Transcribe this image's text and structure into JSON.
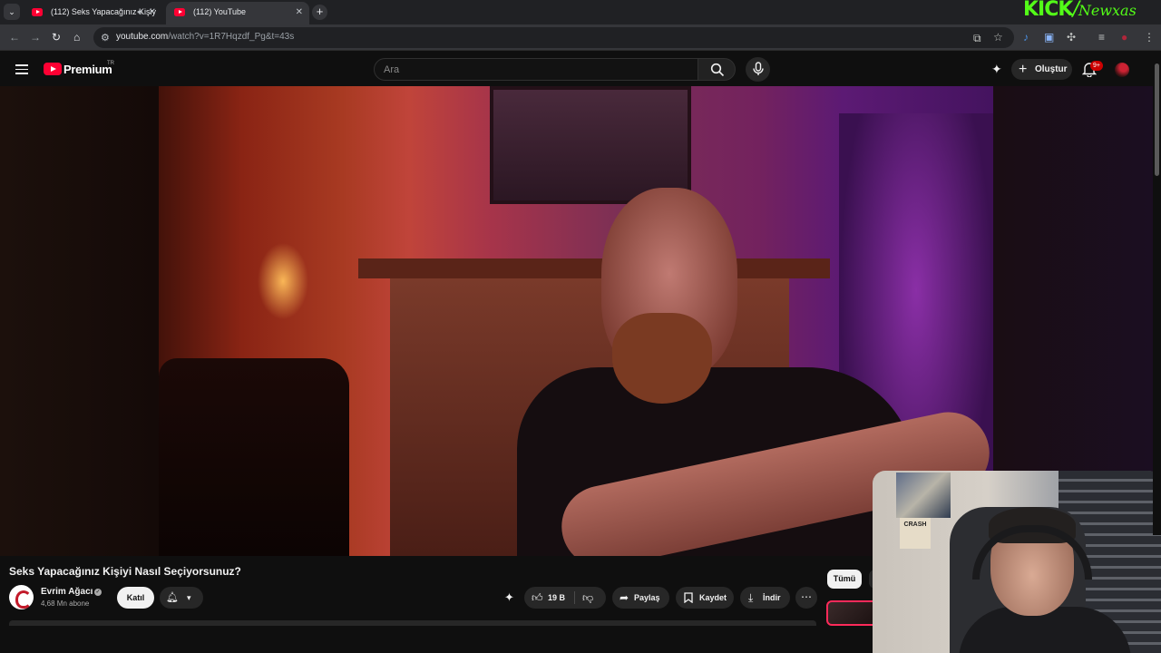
{
  "browser": {
    "tabs": [
      {
        "title": "(112) Seks Yapacağınız Kişiy",
        "active": false,
        "audio": true
      },
      {
        "title": "(112) YouTube",
        "active": true
      }
    ],
    "url_host": "youtube.com",
    "url_rest": "/watch?v=1R7Hqzdf_Pg&t=43s"
  },
  "overlay": {
    "kick_logo": "KICK",
    "kick_separator": "/",
    "kick_handle": "Newxas"
  },
  "youtube": {
    "brand": "Premium",
    "region": "TR",
    "search_placeholder": "Ara",
    "create_label": "Oluştur",
    "notification_badge": "9+"
  },
  "video": {
    "title": "Seks Yapacağınız Kişiyi Nasıl Seçiyorsunuz?",
    "channel_name": "Evrim Ağacı",
    "subscribers": "4,68 Mn abone",
    "join_label": "Katıl",
    "like_count": "19 B",
    "share_label": "Paylaş",
    "save_label": "Kaydet",
    "download_label": "İndir"
  },
  "sidebar": {
    "chip_all": "Tümü"
  },
  "webcam": {
    "poster_text": "CRASH"
  },
  "colors": {
    "youtube_red": "#ff0033",
    "kick_green": "#53fc18",
    "background": "#0f0f0f"
  }
}
